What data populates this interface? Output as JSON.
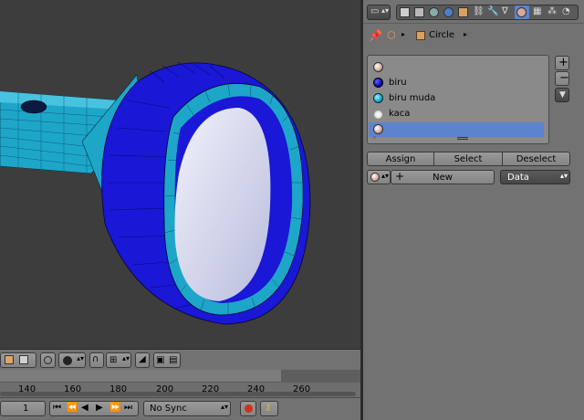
{
  "properties": {
    "context_object_name": "Circle",
    "material_slots": [
      {
        "name": "",
        "color": "#d9a79c",
        "icon": "material-ball-icon"
      },
      {
        "name": "biru",
        "color": "#0a0ab8",
        "icon": "material-ball-icon"
      },
      {
        "name": "biru muda",
        "color": "#17a6c8",
        "icon": "material-ball-icon"
      },
      {
        "name": "kaca",
        "color": "#e6e6e6",
        "icon": "material-ball-icon"
      },
      {
        "name": "",
        "color": "#d9a79c",
        "icon": "material-ball-icon",
        "selected": true
      }
    ],
    "assign_label": "Assign",
    "select_label": "Select",
    "deselect_label": "Deselect",
    "new_label": "New",
    "link_mode": "Data"
  },
  "timeline": {
    "ticks": [
      "140",
      "160",
      "180",
      "200",
      "220",
      "240",
      "260"
    ],
    "current_frame": "1",
    "sync_mode": "No Sync"
  },
  "colors": {
    "mesh_dark_blue": "#1a17d6",
    "mesh_cyan": "#1ea6c9",
    "lens": "#d9dcf0",
    "selection_highlight": "#5b84cc"
  }
}
